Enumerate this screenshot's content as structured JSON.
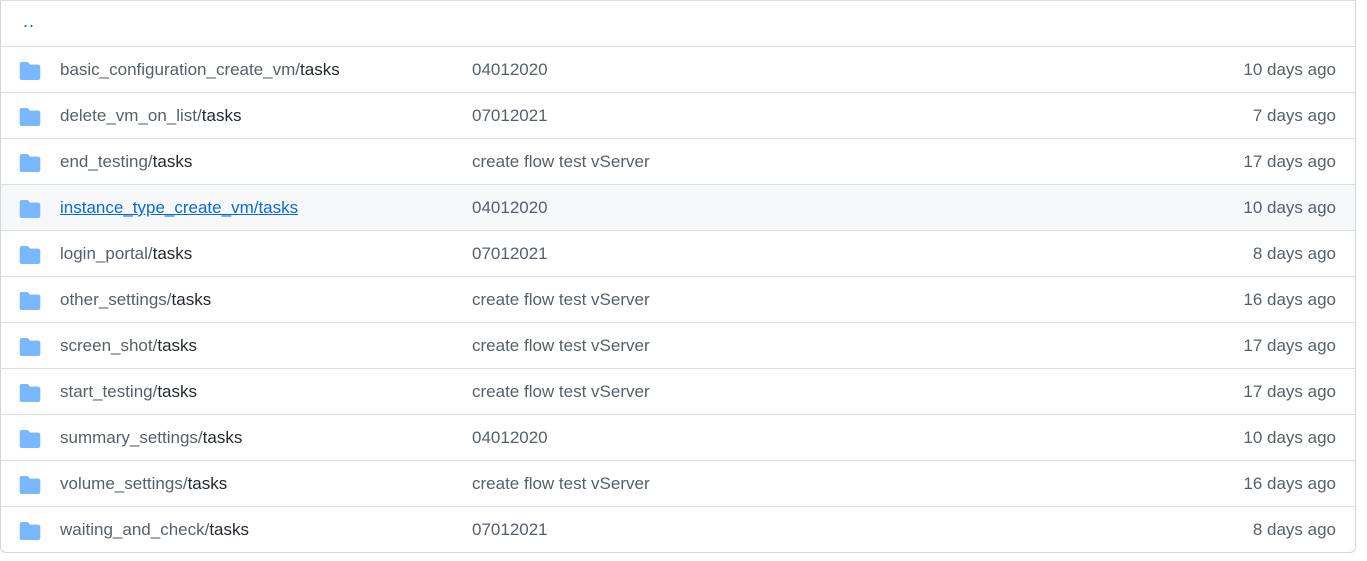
{
  "parent_link": "..",
  "colors": {
    "folder_icon": "#79b8ff",
    "link": "#0969da",
    "muted_text": "#57606a",
    "border": "#d8dee4",
    "hover_row": "#f6f8fa"
  },
  "rows": [
    {
      "dir": "basic_configuration_create_vm/",
      "sub": "tasks",
      "commit": "04012020",
      "age": "10 days ago",
      "icon": "folder-icon"
    },
    {
      "dir": "delete_vm_on_list/",
      "sub": "tasks",
      "commit": "07012021",
      "age": "7 days ago",
      "icon": "folder-icon"
    },
    {
      "dir": "end_testing/",
      "sub": "tasks",
      "commit": "create flow test vServer",
      "age": "17 days ago",
      "icon": "folder-icon"
    },
    {
      "dir": "instance_type_create_vm/",
      "sub": "tasks",
      "commit": "04012020",
      "age": "10 days ago",
      "icon": "folder-icon"
    },
    {
      "dir": "login_portal/",
      "sub": "tasks",
      "commit": "07012021",
      "age": "8 days ago",
      "icon": "folder-icon"
    },
    {
      "dir": "other_settings/",
      "sub": "tasks",
      "commit": "create flow test vServer",
      "age": "16 days ago",
      "icon": "folder-icon"
    },
    {
      "dir": "screen_shot/",
      "sub": "tasks",
      "commit": "create flow test vServer",
      "age": "17 days ago",
      "icon": "folder-icon"
    },
    {
      "dir": "start_testing/",
      "sub": "tasks",
      "commit": "create flow test vServer",
      "age": "17 days ago",
      "icon": "folder-icon"
    },
    {
      "dir": "summary_settings/",
      "sub": "tasks",
      "commit": "04012020",
      "age": "10 days ago",
      "icon": "folder-icon"
    },
    {
      "dir": "volume_settings/",
      "sub": "tasks",
      "commit": "create flow test vServer",
      "age": "16 days ago",
      "icon": "folder-icon"
    },
    {
      "dir": "waiting_and_check/",
      "sub": "tasks",
      "commit": "07012021",
      "age": "8 days ago",
      "icon": "folder-icon"
    }
  ]
}
